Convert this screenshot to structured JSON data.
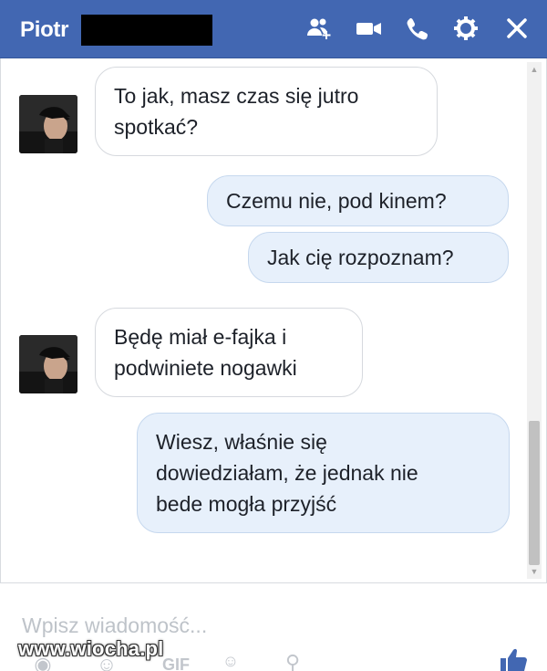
{
  "header": {
    "contact_name": "Piotr",
    "icons": [
      "add-people-icon",
      "video-call-icon",
      "voice-call-icon",
      "settings-gear-icon",
      "close-icon"
    ]
  },
  "colors": {
    "header_bg": "#4267b2",
    "outgoing_bubble": "#e7f0fb",
    "incoming_bubble": "#ffffff"
  },
  "messages": [
    {
      "direction": "incoming",
      "lines": [
        "To jak, masz czas się jutro",
        "spotkać?"
      ]
    },
    {
      "direction": "outgoing",
      "lines": [
        "Czemu nie, pod kinem?"
      ]
    },
    {
      "direction": "outgoing",
      "lines": [
        "Jak cię rozpoznam?"
      ]
    },
    {
      "direction": "incoming",
      "lines": [
        "Będę miał e-fajka i",
        "podwiniete nogawki"
      ]
    },
    {
      "direction": "outgoing",
      "lines": [
        "Wiesz, właśnie się",
        "dowiedziałam, że jednak nie",
        "bede mogła przyjść"
      ]
    }
  ],
  "composer": {
    "placeholder": "Wpisz wiadomość...",
    "icons": [
      "camera-icon",
      "sticker-icon",
      "gif-icon",
      "emoji-icon",
      "attachment-icon",
      "like-icon"
    ]
  },
  "watermark": "www.wiocha.pl"
}
